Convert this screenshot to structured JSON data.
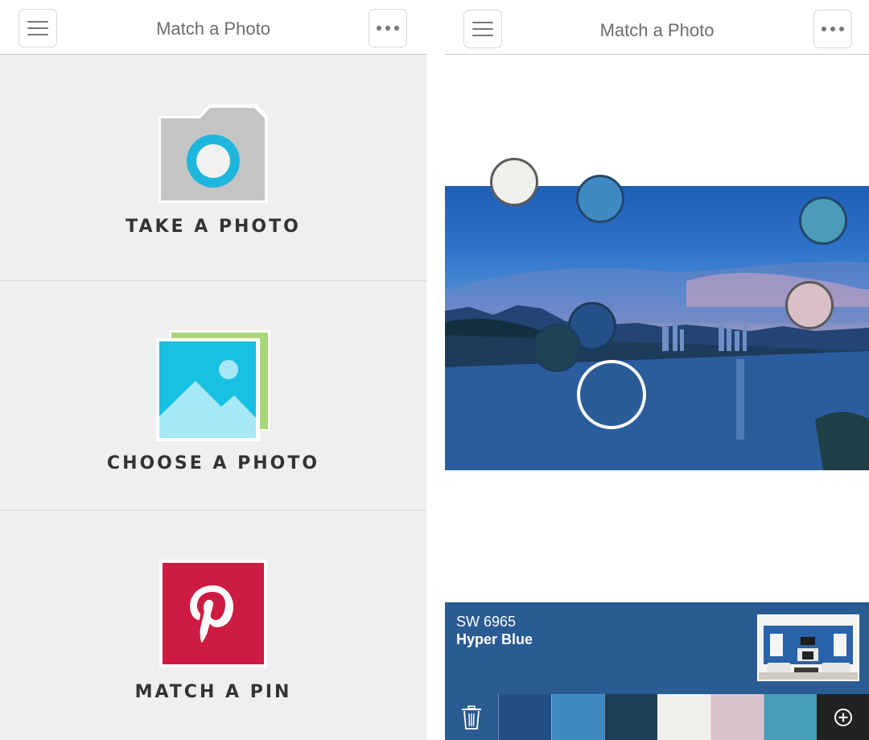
{
  "left_screen": {
    "title": "Match a Photo",
    "menu_icon": "hamburger-menu-icon",
    "more_icon": "more-dots-icon",
    "options": [
      {
        "label": "TAKE A PHOTO",
        "icon": "camera-icon"
      },
      {
        "label": "CHOOSE A PHOTO",
        "icon": "photo-gallery-icon"
      },
      {
        "label": "MATCH A PIN",
        "icon": "pinterest-icon"
      }
    ]
  },
  "right_screen": {
    "title": "Match a Photo",
    "menu_icon": "hamburger-menu-icon",
    "more_icon": "more-dots-icon",
    "selected_color": {
      "code": "SW 6965",
      "name": "Hyper Blue",
      "hex": "#2a5b93"
    },
    "sample_dots": [
      {
        "color": "#f0efec",
        "selected": false
      },
      {
        "color": "#3f8ac3",
        "selected": false
      },
      {
        "color": "#4a9cb6",
        "selected": false
      },
      {
        "color": "#d8c0c6",
        "selected": false
      },
      {
        "color": "#245089",
        "selected": false
      },
      {
        "color": "#1e4556",
        "selected": false
      },
      {
        "color": "#2b5c97",
        "selected": true
      }
    ],
    "palette": [
      "#234f86",
      "#3f8ac3",
      "#1d4057",
      "#efefec",
      "#d9c1c8",
      "#479eb9"
    ],
    "trash_icon": "trash-icon",
    "add_icon": "add-circle-icon"
  },
  "colors": {
    "camera_gray": "#c4c4c4",
    "camera_ring": "#1fb6de",
    "pinterest_red": "#cd1b41",
    "gallery_blue": "#18c0e2",
    "gallery_green": "#a9d57a"
  }
}
